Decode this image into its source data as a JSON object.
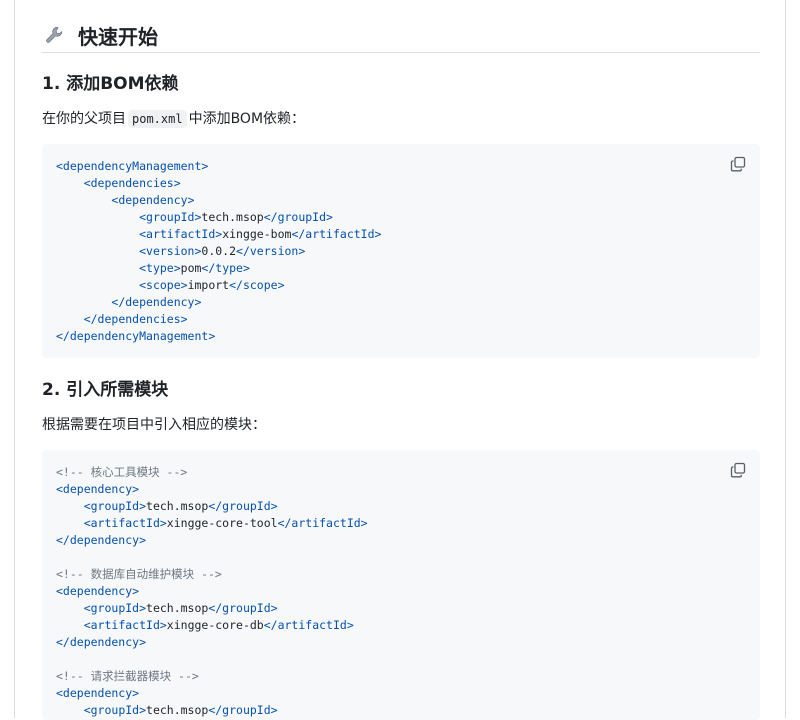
{
  "section": {
    "title": "快速开始"
  },
  "step1": {
    "heading": "1. 添加BOM依赖",
    "desc_before": "在你的父项目",
    "desc_code": "pom.xml",
    "desc_after": "中添加BOM依赖："
  },
  "step2": {
    "heading": "2. 引入所需模块",
    "desc": "根据需要在项目中引入相应的模块："
  },
  "code1": [
    [
      0,
      "tag",
      "dependencyManagement"
    ],
    [
      1,
      "tag",
      "dependencies"
    ],
    [
      2,
      "tag",
      "dependency"
    ],
    [
      3,
      "el",
      "groupId",
      "tech.msop"
    ],
    [
      3,
      "el",
      "artifactId",
      "xingge-bom"
    ],
    [
      3,
      "el",
      "version",
      "0.0.2"
    ],
    [
      3,
      "el",
      "type",
      "pom"
    ],
    [
      3,
      "el",
      "scope",
      "import"
    ],
    [
      2,
      "close",
      "dependency"
    ],
    [
      1,
      "close",
      "dependencies"
    ],
    [
      0,
      "close",
      "dependencyManagement"
    ]
  ],
  "code2": [
    [
      0,
      "comment",
      "<!-- 核心工具模块 -->"
    ],
    [
      0,
      "tag",
      "dependency"
    ],
    [
      1,
      "el",
      "groupId",
      "tech.msop"
    ],
    [
      1,
      "el",
      "artifactId",
      "xingge-core-tool"
    ],
    [
      0,
      "close",
      "dependency"
    ],
    [
      0,
      "blank",
      ""
    ],
    [
      0,
      "comment",
      "<!-- 数据库自动维护模块 -->"
    ],
    [
      0,
      "tag",
      "dependency"
    ],
    [
      1,
      "el",
      "groupId",
      "tech.msop"
    ],
    [
      1,
      "el",
      "artifactId",
      "xingge-core-db"
    ],
    [
      0,
      "close",
      "dependency"
    ],
    [
      0,
      "blank",
      ""
    ],
    [
      0,
      "comment",
      "<!-- 请求拦截器模块 -->"
    ],
    [
      0,
      "tag",
      "dependency"
    ],
    [
      1,
      "el",
      "groupId",
      "tech.msop"
    ]
  ],
  "icons": {
    "heading": "wrench-icon",
    "copy": "copy-icon"
  },
  "colors": {
    "tag": "#0550ae",
    "comment": "#6e7781",
    "code_bg": "#f6f8fa",
    "divider": "#d8dee4"
  }
}
